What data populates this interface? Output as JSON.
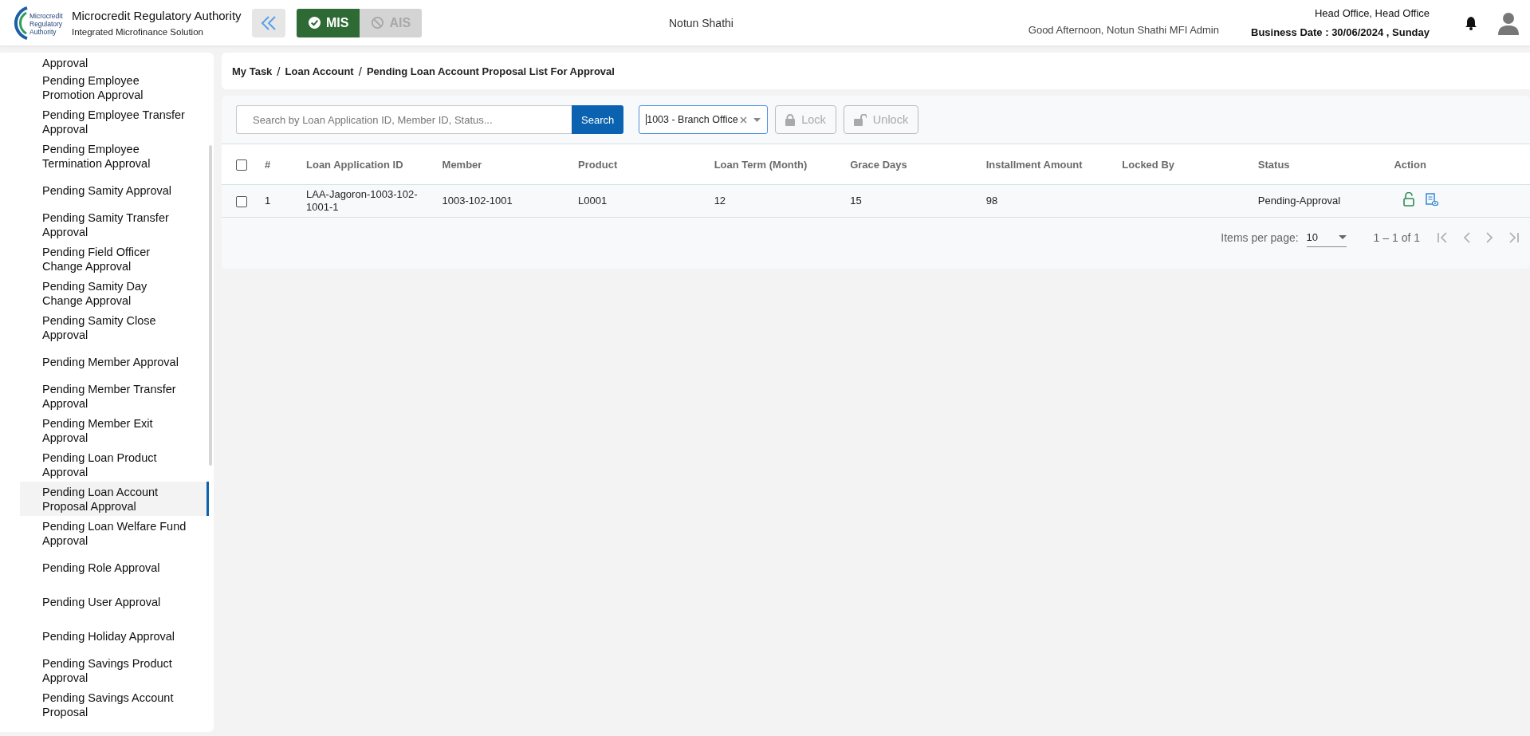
{
  "header": {
    "logo_text": [
      "Microcredit",
      "Regulatory",
      "Authority"
    ],
    "org_name": "Microcredit Regulatory Authority",
    "org_subtitle": "Integrated Microfinance Solution",
    "modules": [
      {
        "label": "MIS",
        "selected": true
      },
      {
        "label": "AIS",
        "selected": false
      }
    ],
    "center_title": "Notun Shathi",
    "greeting": "Good Afternoon, Notun Shathi MFI Admin",
    "office": "Head Office, Head Office",
    "business_date": "Business Date : 30/06/2024 , Sunday"
  },
  "sidebar": {
    "items": [
      {
        "label": "Approval",
        "selected": false
      },
      {
        "label": "Pending Employee Promotion Approval",
        "selected": false
      },
      {
        "label": "Pending Employee Transfer Approval",
        "selected": false
      },
      {
        "label": "Pending Employee Termination Approval",
        "selected": false
      },
      {
        "label": "Pending Samity Approval",
        "selected": false
      },
      {
        "label": "Pending Samity Transfer Approval",
        "selected": false
      },
      {
        "label": "Pending Field Officer Change Approval",
        "selected": false
      },
      {
        "label": "Pending Samity Day Change Approval",
        "selected": false
      },
      {
        "label": "Pending Samity Close Approval",
        "selected": false
      },
      {
        "label": "Pending Member Approval",
        "selected": false
      },
      {
        "label": "Pending Member Transfer Approval",
        "selected": false
      },
      {
        "label": "Pending Member Exit Approval",
        "selected": false
      },
      {
        "label": "Pending Loan Product Approval",
        "selected": false
      },
      {
        "label": "Pending Loan Account Proposal Approval",
        "selected": true
      },
      {
        "label": "Pending Loan Welfare Fund Approval",
        "selected": false
      },
      {
        "label": "Pending Role Approval",
        "selected": false
      },
      {
        "label": "Pending User Approval",
        "selected": false
      },
      {
        "label": "Pending Holiday Approval",
        "selected": false
      },
      {
        "label": "Pending Savings Product Approval",
        "selected": false
      },
      {
        "label": "Pending Savings Account Proposal",
        "selected": false
      }
    ]
  },
  "breadcrumb": {
    "separator": "/",
    "items": [
      "My Task",
      "Loan Account",
      "Pending Loan Account Proposal List For Approval"
    ]
  },
  "toolbar": {
    "search": {
      "placeholder": "Search by Loan Application ID, Member ID, Status..."
    },
    "search_button": "Search",
    "branch_select": {
      "value": "1003 - Branch Office"
    },
    "lock_button": {
      "label": "Lock",
      "disabled": true
    },
    "unlock_button": {
      "label": "Unlock",
      "disabled": true
    }
  },
  "table": {
    "select_all_checked": false,
    "columns": [
      "#",
      "Loan Application ID",
      "Member",
      "Product",
      "Loan Term (Month)",
      "Grace Days",
      "Installment Amount",
      "Locked By",
      "Status",
      "Action"
    ],
    "rows": [
      {
        "checked": false,
        "number": "1",
        "loan_application_id": "LAA-Jagoron-1003-102-1001-1",
        "member": "1003-102-1001",
        "product": "L0001",
        "loan_term": "12",
        "grace_days": "15",
        "installment_amount": "98",
        "status": "Pending-Approval"
      }
    ]
  },
  "paginator": {
    "label": "Items per page:",
    "page_size": "10",
    "range": "1 – 1 of 1"
  }
}
